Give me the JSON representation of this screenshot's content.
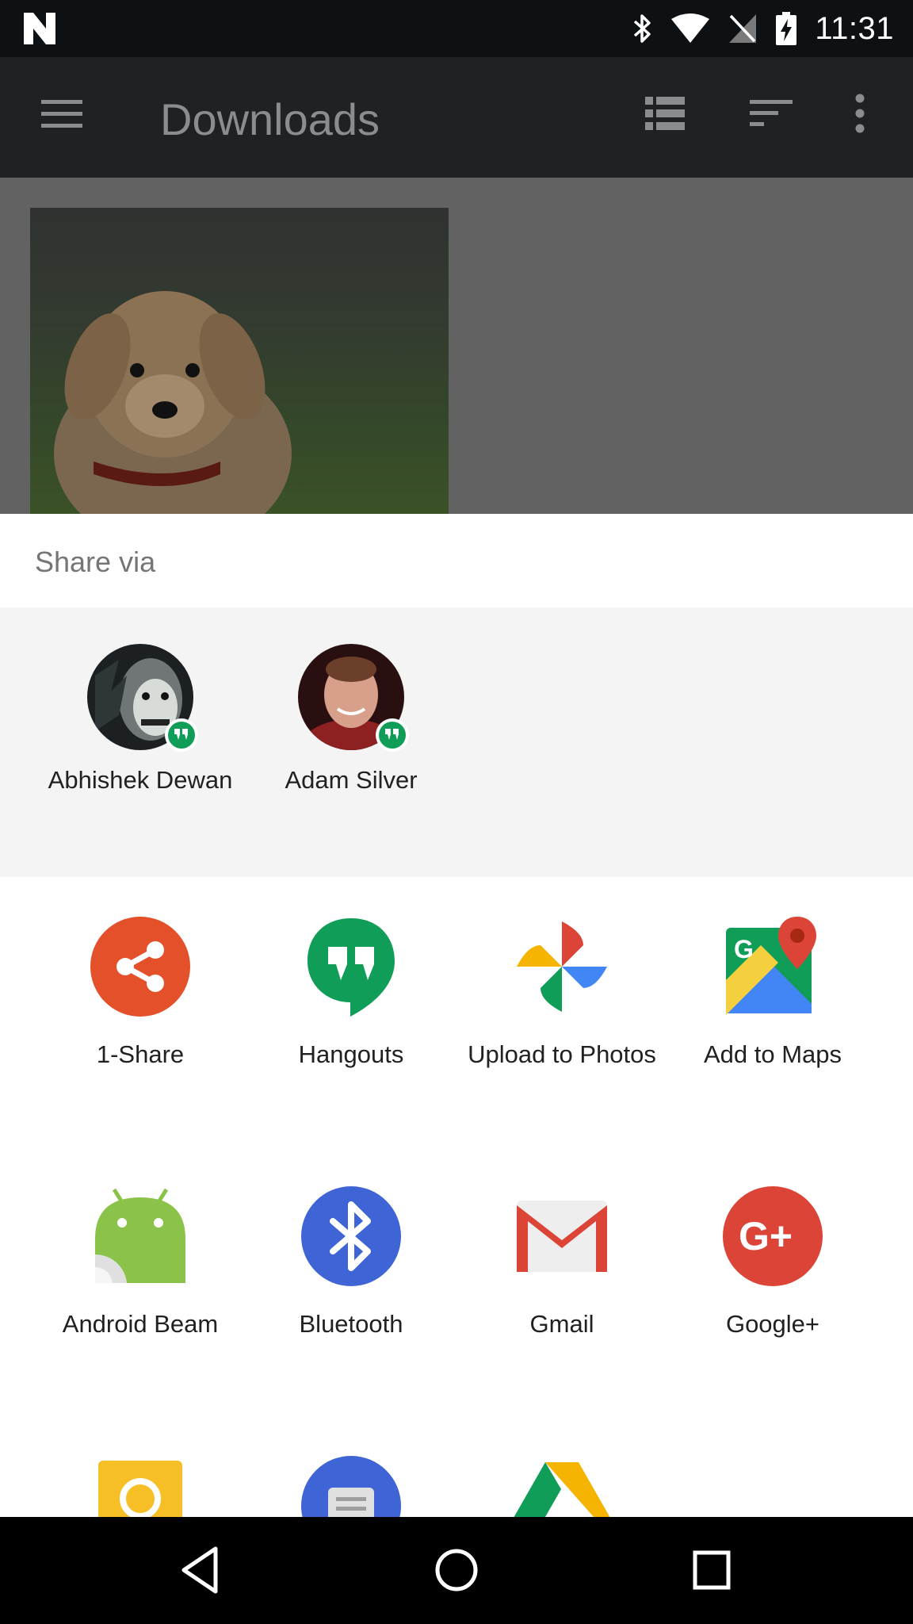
{
  "status_bar": {
    "time": "11:31",
    "icons": [
      "n-logo-icon",
      "bluetooth-icon",
      "wifi-icon",
      "no-signal-icon",
      "battery-charging-icon"
    ]
  },
  "app_bar": {
    "title": "Downloads",
    "icons": [
      "menu-icon",
      "list-view-icon",
      "sort-icon",
      "more-vert-icon"
    ]
  },
  "share_sheet": {
    "title": "Share via",
    "contacts": [
      {
        "name": "Abhishek Dewan",
        "badge": "hangouts-badge-icon"
      },
      {
        "name": "Adam Silver",
        "badge": "hangouts-badge-icon"
      }
    ],
    "apps": [
      {
        "label": "1-Share",
        "icon": "share-icon"
      },
      {
        "label": "Hangouts",
        "icon": "hangouts-icon"
      },
      {
        "label": "Upload to Photos",
        "icon": "photos-icon"
      },
      {
        "label": "Add to Maps",
        "icon": "maps-icon"
      },
      {
        "label": "Android Beam",
        "icon": "android-beam-icon"
      },
      {
        "label": "Bluetooth",
        "icon": "bluetooth-icon"
      },
      {
        "label": "Gmail",
        "icon": "gmail-icon"
      },
      {
        "label": "Google+",
        "icon": "google-plus-icon"
      }
    ],
    "partial_apps": [
      "keep-icon",
      "messenger-icon",
      "drive-icon"
    ]
  },
  "nav_bar": {
    "icons": [
      "back-icon",
      "home-icon",
      "recents-icon"
    ]
  },
  "colors": {
    "share_orange": "#e4502a",
    "hangouts_green": "#0f9d58",
    "bluetooth_blue": "#3f64d6",
    "gplus_red": "#db4437"
  }
}
